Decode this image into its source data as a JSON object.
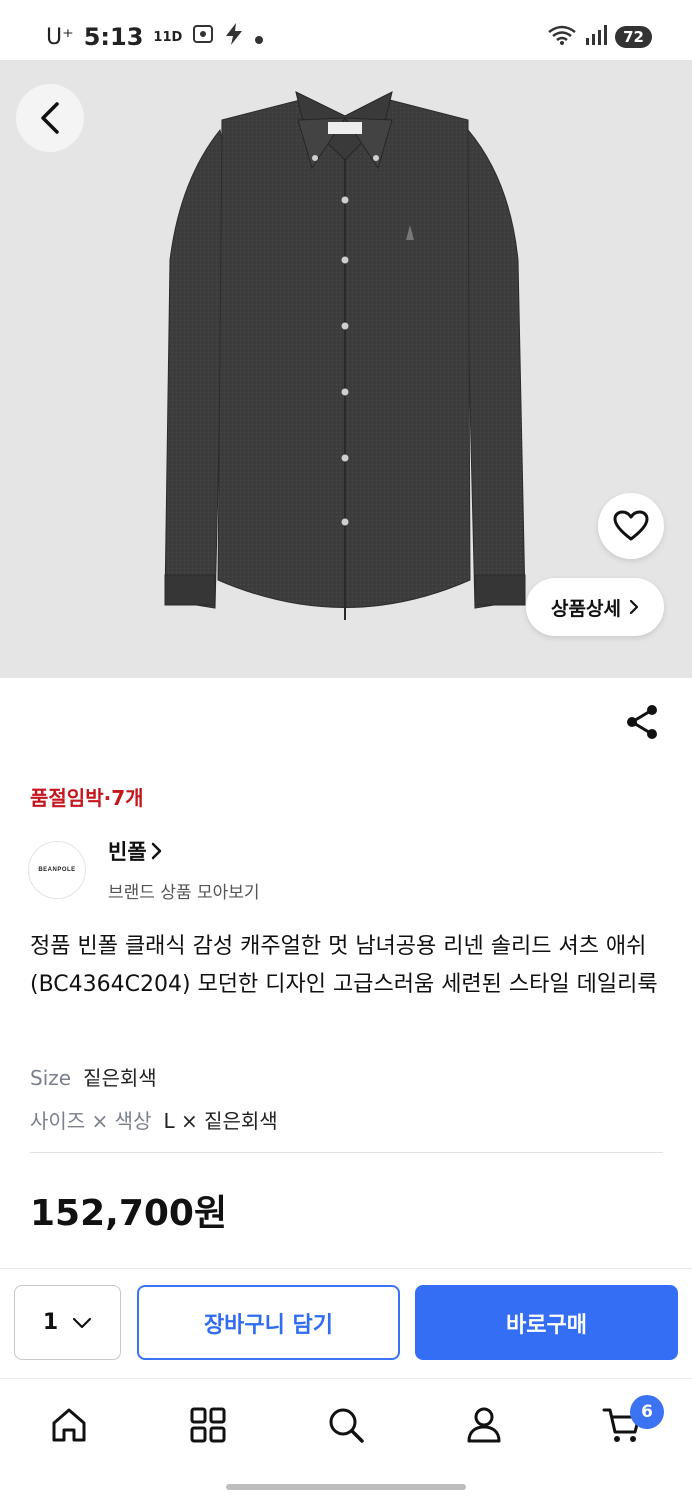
{
  "status_bar": {
    "carrier": "U⁺",
    "time": "5:13",
    "small_indicator": "11D",
    "battery": "72"
  },
  "product": {
    "detail_button_label": "상품상세",
    "stock_notice": "품절임박·7개",
    "brand": {
      "logo_text": "BEANPOLE",
      "name": "빈폴",
      "subtitle": "브랜드 상품 모아보기"
    },
    "title": "정품 빈폴 클래식 감성 캐주얼한 멋 남녀공용 리넨 솔리드 셔츠 애쉬 (BC4364C204) 모던한 디자인 고급스러움 세련된 스타일 데일리룩",
    "options": [
      {
        "label": "Size",
        "value": "짙은회색"
      },
      {
        "label": "사이즈 × 색상",
        "value": "L × 짙은회색"
      }
    ],
    "price": "152,700원",
    "color_theme": {
      "accent": "#346ef5",
      "stock_red": "#c4161c"
    }
  },
  "buy_bar": {
    "quantity": "1",
    "cart_label": "장바구니 담기",
    "buy_label": "바로구매"
  },
  "bottom_nav": {
    "items": [
      "home-icon",
      "grid-icon",
      "search-icon",
      "person-icon",
      "cart-icon"
    ],
    "cart_badge": "6"
  }
}
